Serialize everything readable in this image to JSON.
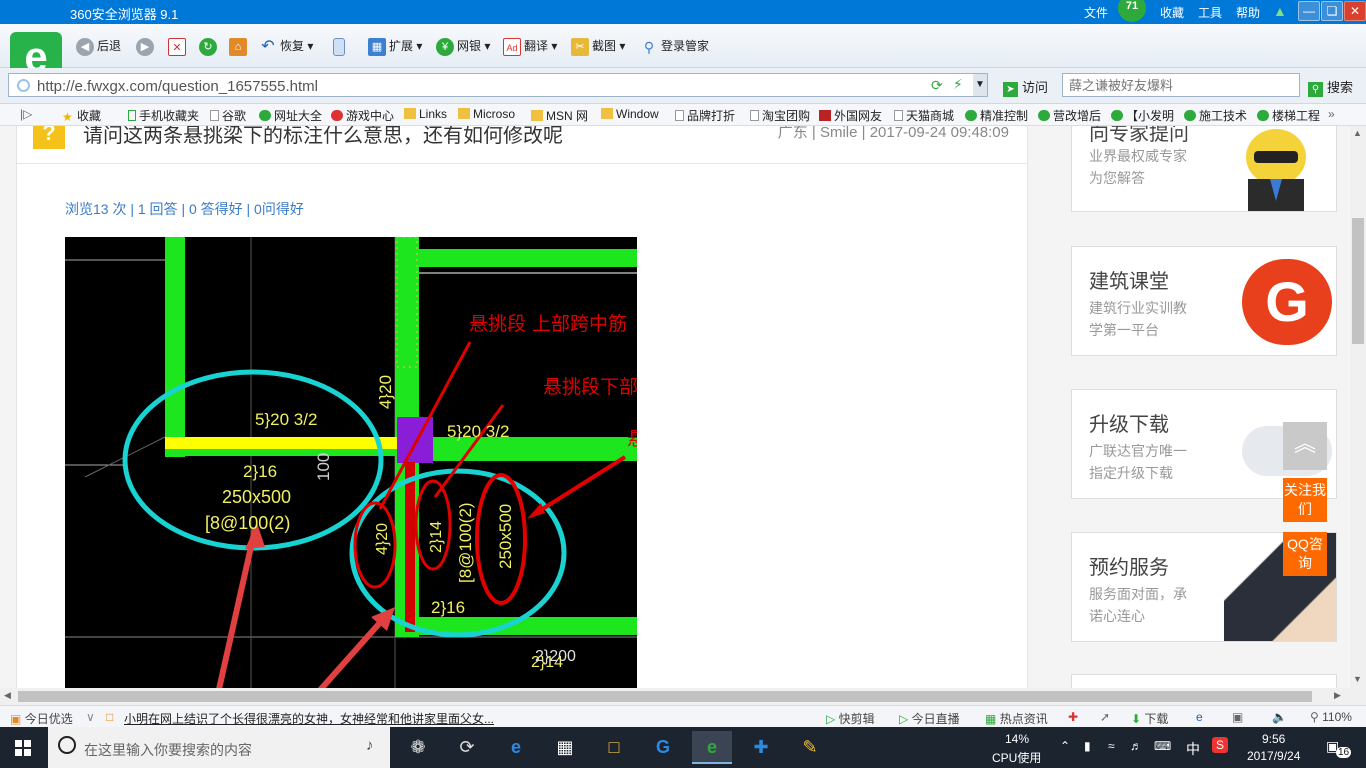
{
  "window": {
    "title": "360安全浏览器 9.1",
    "menu": [
      "文件",
      "收藏",
      "工具",
      "帮助"
    ],
    "badge": "71"
  },
  "toolbar": {
    "back": "后退",
    "restore": "恢复",
    "extend": "扩展",
    "bank": "网银",
    "translate": "翻译",
    "screenshot": "截图",
    "login_manager": "登录管家"
  },
  "address": {
    "url": "http://e.fwxgx.com/question_1657555.html",
    "visit": "访问",
    "search_placeholder": "薛之谦被好友爆料",
    "search_btn": "搜索"
  },
  "bookmarks": [
    "收藏",
    "手机收藏夹",
    "谷歌",
    "网址大全",
    "游戏中心",
    "Links",
    "Microso",
    "MSN 网",
    "Window",
    "品牌打折",
    "淘宝团购",
    "外国网友",
    "天猫商城",
    "精准控制",
    "营改增后",
    "【小发明",
    "施工技术",
    "楼梯工程"
  ],
  "question": {
    "title": "请问这两条悬挑梁下的标注什么意思，还有如何修改呢",
    "meta": "广东 | Smile | 2017-09-24 09:48:09",
    "stats": "浏览13 次 | 1 回答 | 0 答得好 | 0问得好"
  },
  "drawing": {
    "annotation1": "悬挑段 上部跨中筋",
    "annotation2": "悬挑段下部钢筋",
    "annotation3": "悬挑 段截面尺寸",
    "labels": [
      "5}20 3/2",
      "2}16",
      "250x500",
      "[8@100(2)",
      "4}20",
      "5}20 3/2",
      "100",
      "4}20",
      "2}14",
      "[8@100(2)",
      "250x500",
      "2}16",
      "2}14",
      "2}200"
    ]
  },
  "sidebar": {
    "cards": [
      {
        "title": "向专家提问",
        "sub1": "业界最权威专家",
        "sub2": "为您解答"
      },
      {
        "title": "建筑课堂",
        "sub1": "建筑行业实训教",
        "sub2": "学第一平台"
      },
      {
        "title": "升级下载",
        "sub1": "广联达官方唯一",
        "sub2": "指定升级下载"
      },
      {
        "title": "预约服务",
        "sub1": "服务面对面，承",
        "sub2": "诺心连心"
      }
    ],
    "follow": "关注我们",
    "qq": "QQ咨询"
  },
  "status": {
    "today": "今日优选",
    "news": "小明在网上结识了个长得很漂亮的女神，女神经常和他讲家里面父女...",
    "clip": "快剪辑",
    "live": "今日直播",
    "hot": "热点资讯",
    "download": "下载",
    "zoom": "110%"
  },
  "taskbar": {
    "search": "在这里输入你要搜索的内容",
    "cpu": "14%",
    "cpu_label": "CPU使用",
    "ime": "中",
    "time": "9:56",
    "date": "2017/9/24",
    "notifications": "16"
  }
}
